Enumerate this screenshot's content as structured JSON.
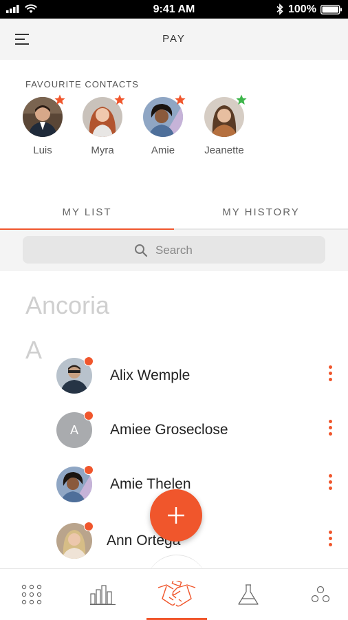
{
  "status_bar": {
    "time": "9:41 AM",
    "battery": "100%"
  },
  "header": {
    "title": "PAY",
    "menu_icon": "hamburger-menu-icon"
  },
  "favourites": {
    "title": "FAVOURITE CONTACTS",
    "items": [
      {
        "name": "Luis",
        "star_color": "#f0562c"
      },
      {
        "name": "Myra",
        "star_color": "#f0562c"
      },
      {
        "name": "Amie",
        "star_color": "#f0562c"
      },
      {
        "name": "Jeanette",
        "star_color": "#3cb54a"
      }
    ]
  },
  "tabs": {
    "my_list": "MY LIST",
    "my_history": "MY HISTORY",
    "active": "MY LIST"
  },
  "search": {
    "placeholder": "Search",
    "icon": "search-icon"
  },
  "list": {
    "section_title": "Ancoria",
    "letter": "A",
    "contacts": [
      {
        "name": "Alix Wemple"
      },
      {
        "name": "Amiee Groseclose",
        "initial": "A"
      },
      {
        "name": "Amie Thelen"
      },
      {
        "name": "Ann Ortega"
      }
    ]
  },
  "fab": {
    "icon": "plus-icon"
  },
  "bottom_nav": {
    "items": [
      "grid-icon",
      "bar-chart-icon",
      "handshake-icon",
      "flask-icon",
      "circles-icon"
    ],
    "active": "handshake-icon"
  },
  "colors": {
    "accent": "#f0562c",
    "star_green": "#3cb54a",
    "search_bg": "#e6e6e6"
  }
}
